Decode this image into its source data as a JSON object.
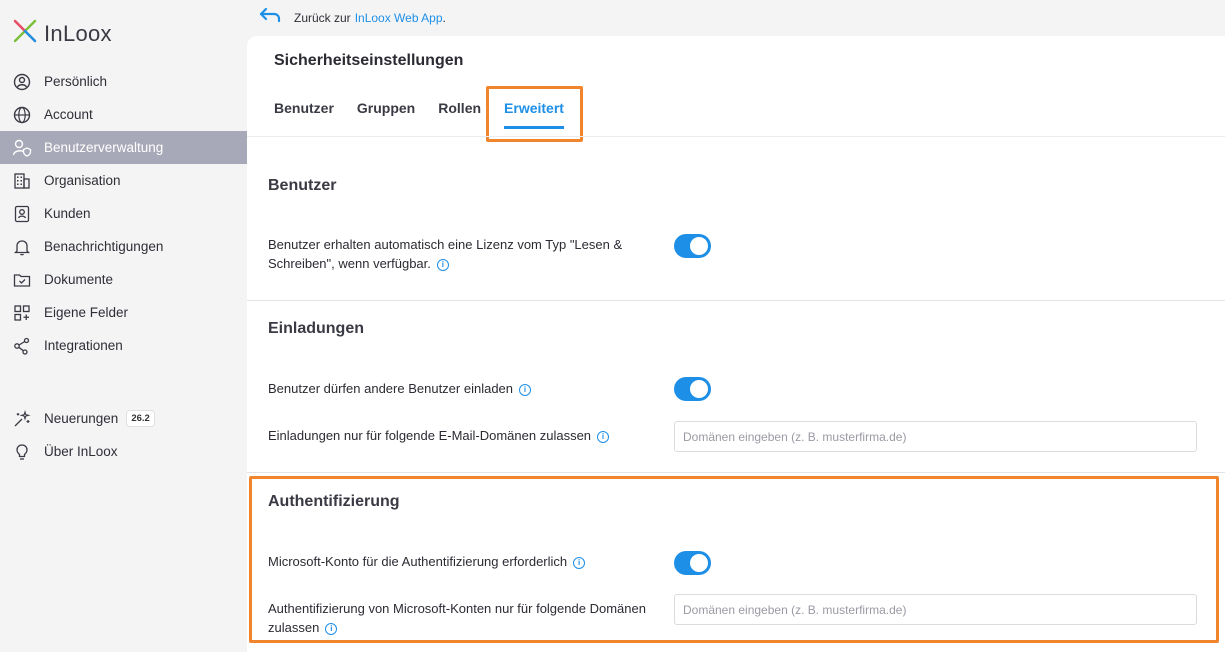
{
  "brand": {
    "name": "InLoox"
  },
  "sidebar": {
    "items": [
      {
        "label": "Persönlich",
        "icon": "user-circle-icon"
      },
      {
        "label": "Account",
        "icon": "globe-icon"
      },
      {
        "label": "Benutzerverwaltung",
        "icon": "user-shield-icon",
        "active": true
      },
      {
        "label": "Organisation",
        "icon": "building-icon"
      },
      {
        "label": "Kunden",
        "icon": "contact-card-icon"
      },
      {
        "label": "Benachrichtigungen",
        "icon": "bell-icon"
      },
      {
        "label": "Dokumente",
        "icon": "folder-check-icon"
      },
      {
        "label": "Eigene Felder",
        "icon": "grid-plus-icon"
      },
      {
        "label": "Integrationen",
        "icon": "share-nodes-icon"
      }
    ],
    "secondary": [
      {
        "label": "Neuerungen",
        "badge": "26.2",
        "icon": "sparkle-icon"
      },
      {
        "label": "Über InLoox",
        "icon": "lightbulb-icon"
      }
    ]
  },
  "backlink": {
    "prefix": "Zurück zur",
    "link": "InLoox Web App",
    "suffix": "."
  },
  "page": {
    "title": "Sicherheitseinstellungen",
    "tabs": [
      "Benutzer",
      "Gruppen",
      "Rollen",
      "Erweitert"
    ],
    "active_tab": "Erweitert"
  },
  "sections": {
    "benutzer": {
      "title": "Benutzer",
      "license_label": "Benutzer erhalten automatisch eine Lizenz vom Typ \"Lesen & Schreiben\", wenn verfügbar.",
      "license_enabled": true
    },
    "einladungen": {
      "title": "Einladungen",
      "invite_label": "Benutzer dürfen andere Benutzer einladen",
      "invite_enabled": true,
      "domains_label": "Einladungen nur für folgende E-Mail-Domänen zulassen",
      "domains_placeholder": "Domänen eingeben (z. B. musterfirma.de)"
    },
    "authentifizierung": {
      "title": "Authentifizierung",
      "ms_label": "Microsoft-Konto für die Authentifizierung erforderlich",
      "ms_enabled": true,
      "ms_domains_label": "Authentifizierung von Microsoft-Konten nur für folgende Domänen zulassen",
      "ms_domains_placeholder": "Domänen eingeben (z. B. musterfirma.de)"
    }
  },
  "colors": {
    "accent": "#1e8fe6",
    "highlight": "#f0852d",
    "active_nav": "#a8a9b8"
  }
}
